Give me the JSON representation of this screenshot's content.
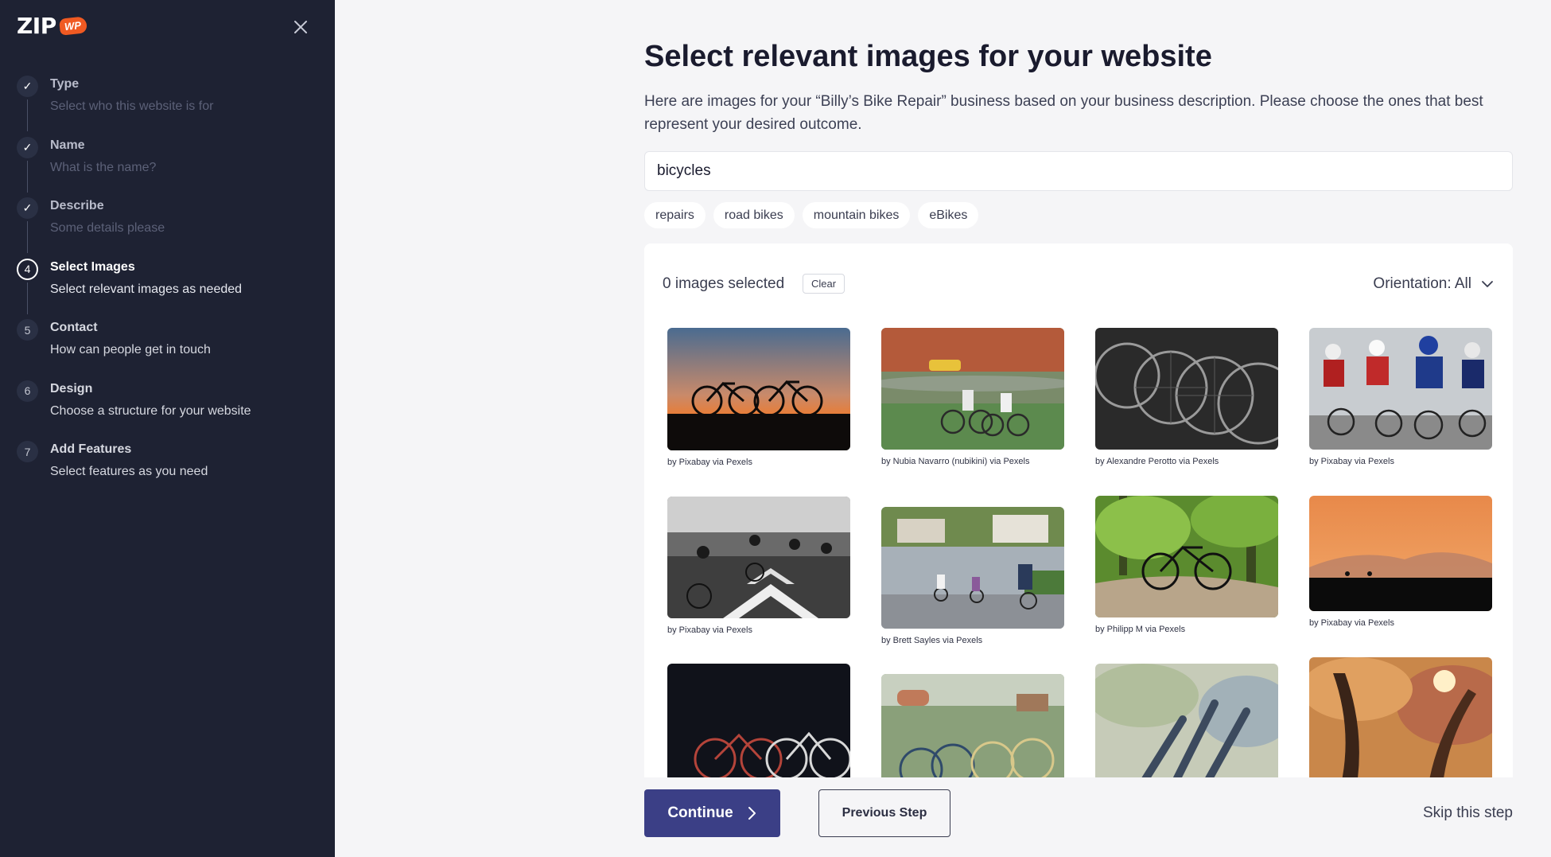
{
  "sidebar": {
    "logo_text": "ZIP",
    "logo_badge": "WP",
    "steps": [
      {
        "marker": "✓",
        "title": "Type",
        "desc": "Select who this website is for",
        "state": "done"
      },
      {
        "marker": "✓",
        "title": "Name",
        "desc": "What is the name?",
        "state": "done"
      },
      {
        "marker": "✓",
        "title": "Describe",
        "desc": "Some details please",
        "state": "done"
      },
      {
        "marker": "4",
        "title": "Select Images",
        "desc": "Select relevant images as needed",
        "state": "current"
      },
      {
        "marker": "5",
        "title": "Contact",
        "desc": "How can people get in touch",
        "state": "todo"
      },
      {
        "marker": "6",
        "title": "Design",
        "desc": "Choose a structure for your website",
        "state": "todo"
      },
      {
        "marker": "7",
        "title": "Add Features",
        "desc": "Select features as you need",
        "state": "todo"
      }
    ]
  },
  "main": {
    "title": "Select relevant images for your website",
    "description": "Here are images for your “Billy’s Bike Repair” business based on your business description. Please choose the ones that best represent your desired outcome.",
    "search_value": "bicycles",
    "tags": [
      "repairs",
      "road bikes",
      "mountain bikes",
      "eBikes"
    ],
    "selected_count": "0 images selected",
    "clear_label": "Clear",
    "orientation_label": "Orientation: All",
    "images": [
      {
        "credit": "by Pixabay via Pexels"
      },
      {
        "credit": "by Nubia Navarro (nubikini) via Pexels"
      },
      {
        "credit": "by Alexandre Perotto via Pexels"
      },
      {
        "credit": "by Pixabay via Pexels"
      },
      {
        "credit": "by Pixabay via Pexels"
      },
      {
        "credit": "by Brett Sayles via Pexels"
      },
      {
        "credit": "by Philipp M via Pexels"
      },
      {
        "credit": "by Pixabay via Pexels"
      },
      {
        "credit": ""
      },
      {
        "credit": ""
      },
      {
        "credit": ""
      },
      {
        "credit": ""
      }
    ]
  },
  "footer": {
    "continue_label": "Continue",
    "previous_label": "Previous Step",
    "skip_label": "Skip this step"
  },
  "colors": {
    "sidebar_bg": "#1e2233",
    "main_bg": "#f5f5f7",
    "accent": "#3b3f86",
    "logo_badge": "#f05a22"
  },
  "icons": {
    "close": "close-icon",
    "check": "check-icon",
    "chevron_down": "chevron-down-icon",
    "chevron_right": "chevron-right-icon"
  }
}
